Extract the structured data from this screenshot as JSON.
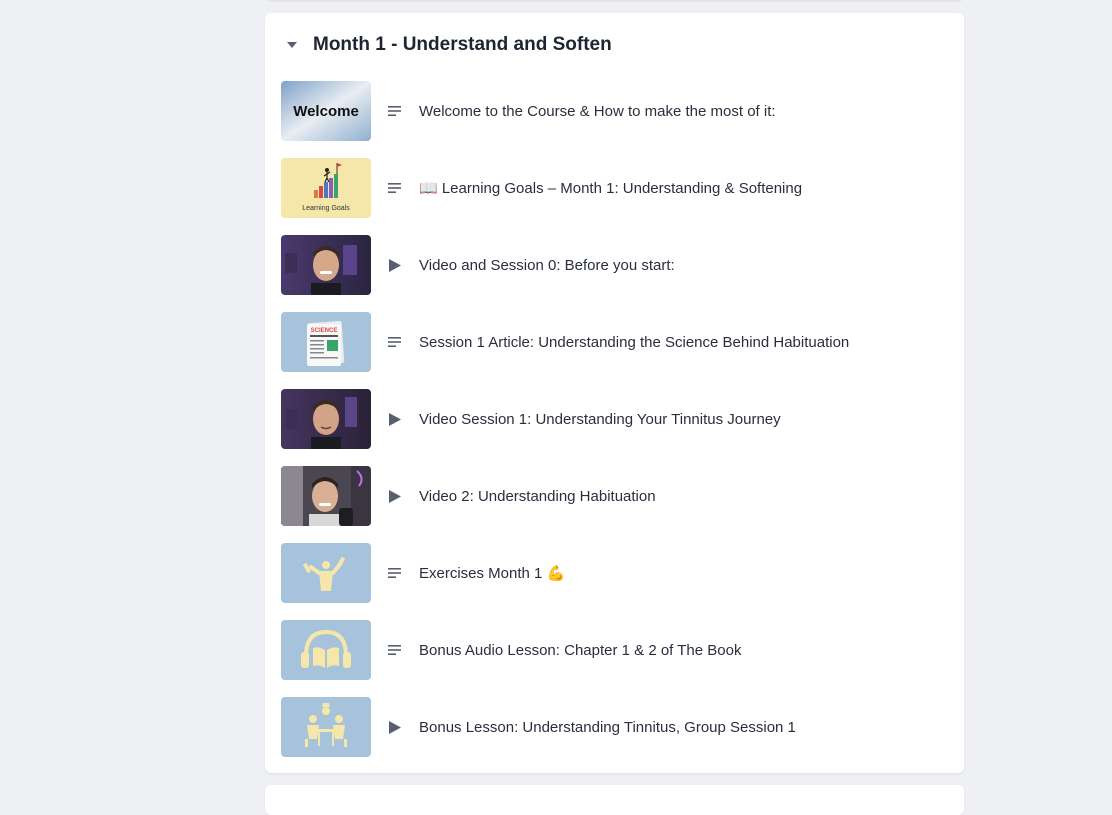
{
  "section": {
    "title": "Month 1 - Understand and Soften",
    "expanded": true
  },
  "lessons": [
    {
      "title": "Welcome to the Course & How to make the most of it:",
      "type": "text",
      "thumb_icon": "welcome-banner",
      "thumb_text": "Welcome"
    },
    {
      "title": "📖 Learning Goals – Month 1: Understanding & Softening",
      "type": "text",
      "thumb_icon": "stairs-flag",
      "thumb_text": "Learning Goals"
    },
    {
      "title": "Video and Session 0: Before you start:",
      "type": "video",
      "thumb_icon": "presenter-photo"
    },
    {
      "title": "Session 1 Article: Understanding the Science Behind Habituation",
      "type": "text",
      "thumb_icon": "newspaper",
      "thumb_text": "SCIENCE"
    },
    {
      "title": "Video Session 1: Understanding Your Tinnitus Journey",
      "type": "video",
      "thumb_icon": "presenter-photo"
    },
    {
      "title": "Video 2: Understanding Habituation",
      "type": "video",
      "thumb_icon": "presenter-photo"
    },
    {
      "title": "Exercises Month 1 💪",
      "type": "text",
      "thumb_icon": "dumbbell-person"
    },
    {
      "title": "Bonus Audio Lesson: Chapter 1 & 2 of The Book",
      "type": "text",
      "thumb_icon": "headphones-book"
    },
    {
      "title": "Bonus Lesson: Understanding Tinnitus, Group Session 1",
      "type": "video",
      "thumb_icon": "group-table"
    }
  ],
  "colors": {
    "page_bg": "#eff0f3",
    "card_bg": "#ffffff",
    "title_text": "#1f2433",
    "lesson_text": "#2a2f3d",
    "icon": "#585f6e",
    "thumb_blue": "#a7c3dc",
    "thumb_yellow": "#f4e7a9"
  }
}
